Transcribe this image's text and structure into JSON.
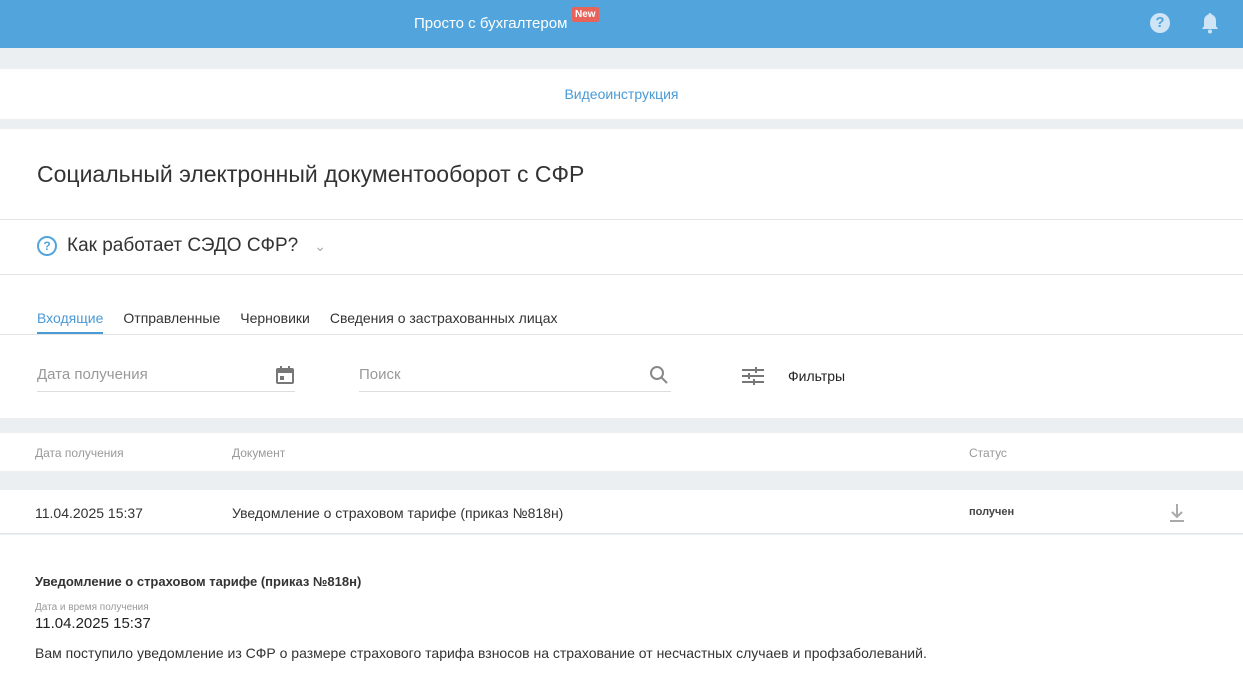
{
  "header": {
    "brand": "Просто с бухгалтером",
    "badge": "New",
    "help_icon": "question-circle-icon",
    "bell_icon": "bell-icon"
  },
  "video_link": "Видеоинструкция",
  "page_title": "Социальный электронный документооборот с СФР",
  "how_it_works": "Как работает СЭДО СФР?",
  "tabs": [
    {
      "label": "Входящие",
      "active": true
    },
    {
      "label": "Отправленные"
    },
    {
      "label": "Черновики"
    },
    {
      "label": "Сведения о застрахованных лицах"
    }
  ],
  "filters": {
    "date_placeholder": "Дата получения",
    "search_placeholder": "Поиск",
    "filters_label": "Фильтры"
  },
  "table": {
    "columns": [
      "Дата получения",
      "Документ",
      "Статус"
    ],
    "rows": [
      {
        "date": "11.04.2025 15:37",
        "document": "Уведомление о страховом тарифе (приказ №818н)",
        "status": "получен"
      }
    ]
  },
  "detail": {
    "title": "Уведомление о страховом тарифе (приказ №818н)",
    "date_label": "Дата и время получения",
    "date": "11.04.2025 15:37",
    "text": "Вам поступило уведомление из СФР о размере страхового тарифа взносов на страхование от несчастных случаев и профзаболеваний."
  }
}
